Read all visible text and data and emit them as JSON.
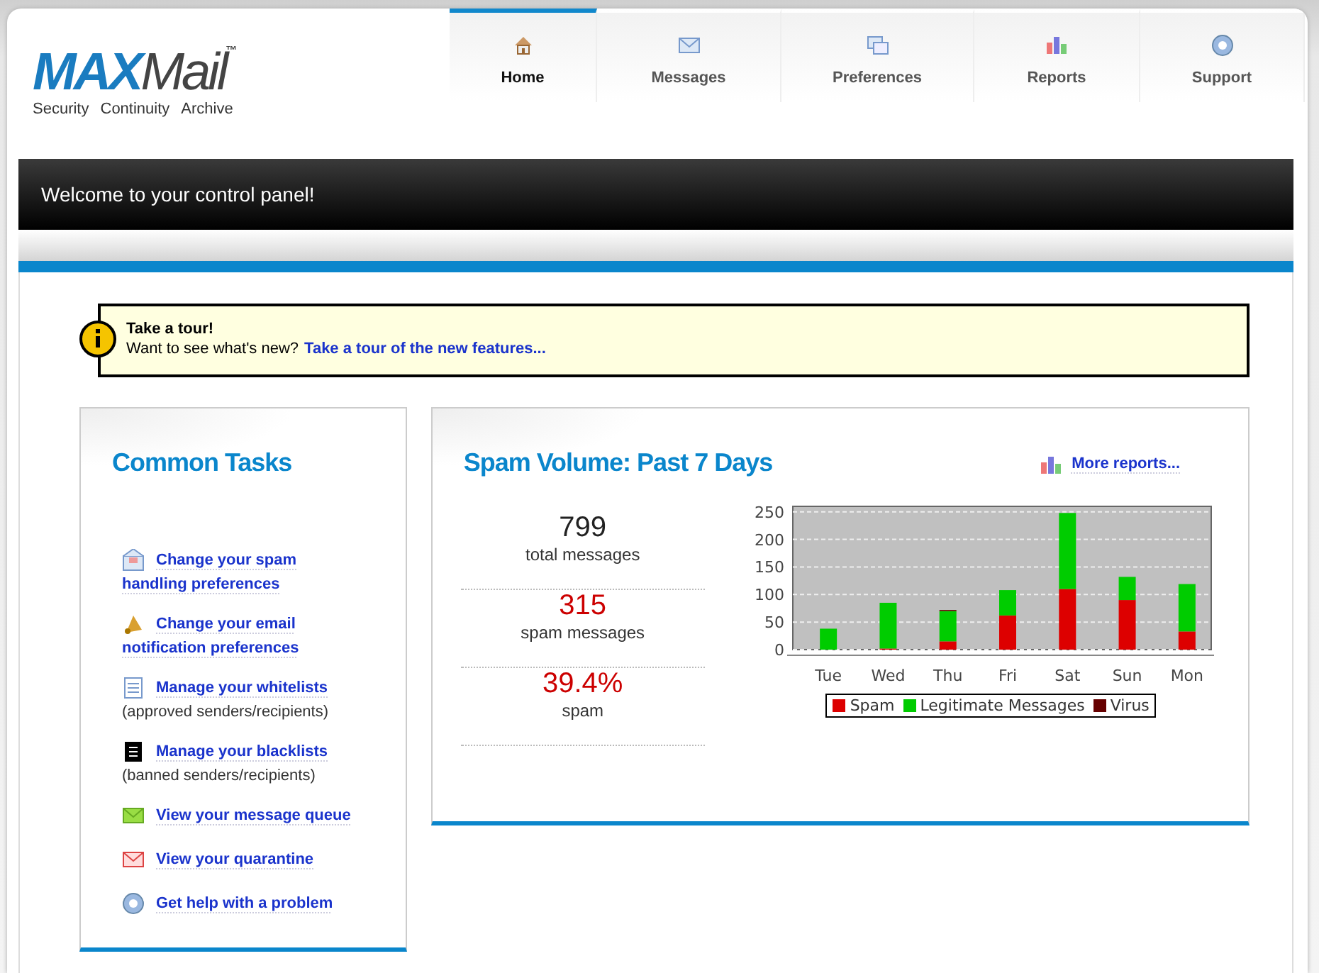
{
  "logo": {
    "brand_strong": "MAX",
    "brand": "Mail",
    "trademark": "™",
    "tagline": [
      "Security",
      "Continuity",
      "Archive"
    ]
  },
  "tabs": [
    {
      "label": "Home",
      "selected": true
    },
    {
      "label": "Messages",
      "selected": false
    },
    {
      "label": "Preferences",
      "selected": false
    },
    {
      "label": "Reports",
      "selected": false
    },
    {
      "label": "Support",
      "selected": false
    }
  ],
  "banner": {
    "title": "Welcome to your control panel!"
  },
  "tour": {
    "title": "Take a tour!",
    "text": "Want to see what's new?",
    "link": "Take a tour of the new features..."
  },
  "tasks": {
    "title": "Common Tasks",
    "items": [
      {
        "link_lines": [
          "Change your spam",
          "handling preferences"
        ]
      },
      {
        "link_lines": [
          "Change your email",
          "notification preferences"
        ]
      },
      {
        "link_lines": [
          "Manage your whitelists"
        ],
        "note": "(approved senders/recipients)"
      },
      {
        "link_lines": [
          "Manage your blacklists"
        ],
        "note": "(banned senders/recipients)"
      },
      {
        "link_lines": [
          "View your message queue"
        ]
      },
      {
        "link_lines": [
          "View your quarantine"
        ]
      },
      {
        "link_lines": [
          "Get help with a problem"
        ]
      }
    ]
  },
  "spam_volume": {
    "title": "Spam Volume: Past 7 Days",
    "more_link": "More reports...",
    "stats": [
      {
        "kind": "total",
        "value": "799",
        "label": "total messages"
      },
      {
        "kind": "spam",
        "value": "315",
        "label": "spam messages"
      },
      {
        "kind": "spam",
        "value": "39.4%",
        "label": "spam"
      }
    ],
    "chart_data": {
      "type": "bar",
      "stacked": true,
      "grid": true,
      "categories": [
        "Tue",
        "Wed",
        "Thu",
        "Fri",
        "Sat",
        "Sun",
        "Mon"
      ],
      "ylim": [
        0,
        260
      ],
      "yticks": [
        0,
        50,
        100,
        150,
        200,
        250
      ],
      "series": [
        {
          "name": "Spam",
          "color": "#dd0000",
          "values": [
            0,
            2,
            15,
            62,
            110,
            90,
            33
          ]
        },
        {
          "name": "Legitimate Messages",
          "color": "#00cc00",
          "values": [
            38,
            83,
            55,
            46,
            138,
            42,
            86
          ]
        },
        {
          "name": "Virus",
          "color": "#660000",
          "values": [
            0,
            0,
            2,
            0,
            0,
            0,
            0
          ]
        }
      ]
    }
  }
}
